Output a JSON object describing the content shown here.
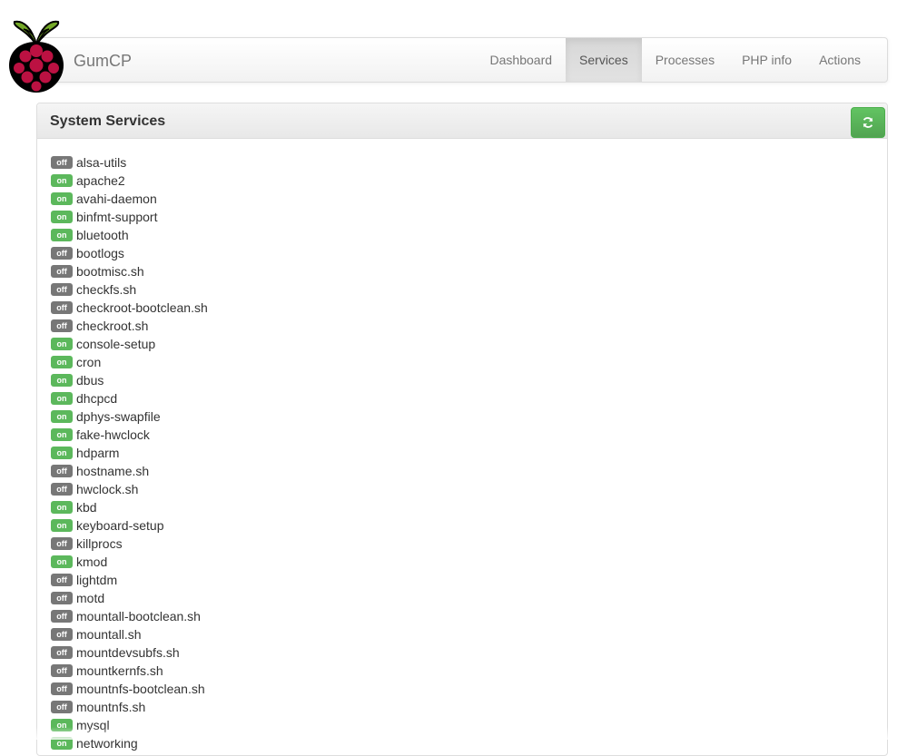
{
  "header": {
    "brand": "GumCP",
    "nav": [
      "Dashboard",
      "Services",
      "Processes",
      "PHP info",
      "Actions"
    ],
    "active_nav": "Services"
  },
  "panel": {
    "title": "System Services",
    "refresh_icon": "refresh-icon"
  },
  "colors": {
    "on": "#5cb85c",
    "off": "#777777",
    "accent": "#5cb85c"
  },
  "services": [
    {
      "status": "off",
      "name": "alsa-utils"
    },
    {
      "status": "on",
      "name": "apache2"
    },
    {
      "status": "on",
      "name": "avahi-daemon"
    },
    {
      "status": "on",
      "name": "binfmt-support"
    },
    {
      "status": "on",
      "name": "bluetooth"
    },
    {
      "status": "off",
      "name": "bootlogs"
    },
    {
      "status": "off",
      "name": "bootmisc.sh"
    },
    {
      "status": "off",
      "name": "checkfs.sh"
    },
    {
      "status": "off",
      "name": "checkroot-bootclean.sh"
    },
    {
      "status": "off",
      "name": "checkroot.sh"
    },
    {
      "status": "on",
      "name": "console-setup"
    },
    {
      "status": "on",
      "name": "cron"
    },
    {
      "status": "on",
      "name": "dbus"
    },
    {
      "status": "on",
      "name": "dhcpcd"
    },
    {
      "status": "on",
      "name": "dphys-swapfile"
    },
    {
      "status": "on",
      "name": "fake-hwclock"
    },
    {
      "status": "on",
      "name": "hdparm"
    },
    {
      "status": "off",
      "name": "hostname.sh"
    },
    {
      "status": "off",
      "name": "hwclock.sh"
    },
    {
      "status": "on",
      "name": "kbd"
    },
    {
      "status": "on",
      "name": "keyboard-setup"
    },
    {
      "status": "off",
      "name": "killprocs"
    },
    {
      "status": "on",
      "name": "kmod"
    },
    {
      "status": "off",
      "name": "lightdm"
    },
    {
      "status": "off",
      "name": "motd"
    },
    {
      "status": "off",
      "name": "mountall-bootclean.sh"
    },
    {
      "status": "off",
      "name": "mountall.sh"
    },
    {
      "status": "off",
      "name": "mountdevsubfs.sh"
    },
    {
      "status": "off",
      "name": "mountkernfs.sh"
    },
    {
      "status": "off",
      "name": "mountnfs-bootclean.sh"
    },
    {
      "status": "off",
      "name": "mountnfs.sh"
    },
    {
      "status": "on",
      "name": "mysql"
    },
    {
      "status": "on",
      "name": "networking"
    }
  ]
}
